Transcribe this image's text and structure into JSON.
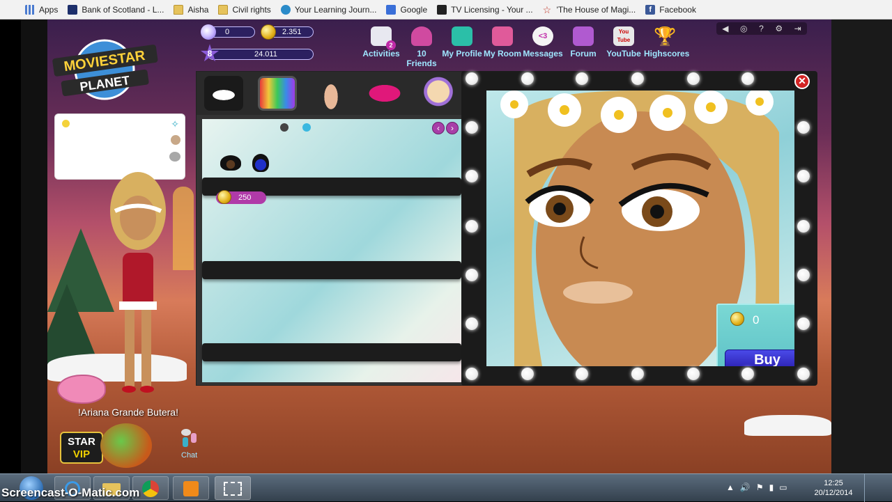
{
  "bookmarks": [
    {
      "label": "Apps",
      "icon": "apps-grid-icon"
    },
    {
      "label": "Bank of Scotland - L...",
      "icon": "bank-icon"
    },
    {
      "label": "Aisha",
      "icon": "folder-icon"
    },
    {
      "label": "Civil rights",
      "icon": "folder-icon"
    },
    {
      "label": "Your Learning Journ...",
      "icon": "learning-icon"
    },
    {
      "label": "Google",
      "icon": "google-icon"
    },
    {
      "label": "TV Licensing - Your ...",
      "icon": "tv-icon"
    },
    {
      "label": "'The House of Magi...",
      "icon": "star-icon"
    },
    {
      "label": "Facebook",
      "icon": "facebook-icon"
    }
  ],
  "hud": {
    "diamonds": "0",
    "coins": "2.351",
    "level": "8",
    "fame": "24.011"
  },
  "logo": {
    "line1": "MOVIESTAR",
    "line2": "PLANET"
  },
  "toolbar": [
    {
      "label": "Activities",
      "icon": "activities-icon",
      "badge": "2"
    },
    {
      "label": "10 Friends",
      "icon": "friends-icon"
    },
    {
      "label": "My Profile",
      "icon": "profile-icon"
    },
    {
      "label": "My Room",
      "icon": "room-icon"
    },
    {
      "label": "Messages",
      "icon": "messages-icon",
      "badge": "<3"
    },
    {
      "label": "Forum",
      "icon": "forum-icon"
    },
    {
      "label": "YouTube",
      "icon": "youtube-icon",
      "icon_text": "You Tube"
    },
    {
      "label": "Highscores",
      "icon": "trophy-icon"
    }
  ],
  "avatar": {
    "username": "!Ariana Grande Butera!"
  },
  "vip": {
    "line1": "STAR",
    "line2": "VIP"
  },
  "chat": {
    "label": "Chat"
  },
  "shop": {
    "price": "250",
    "prev": "‹",
    "next": "›",
    "categories": [
      "eyes",
      "eyeshadow",
      "nose",
      "lips",
      "skin"
    ]
  },
  "preview": {
    "close": "✕",
    "total": "0",
    "buy_label": "Buy"
  },
  "taskbar": {
    "watermark": "Screencast-O-Matic.com",
    "time": "12:25",
    "date": "20/12/2014"
  },
  "colors": {
    "accent_cyan": "#9fe6ff",
    "buy_button": "#2a1fb0",
    "price_tag": "#b03aa8"
  }
}
